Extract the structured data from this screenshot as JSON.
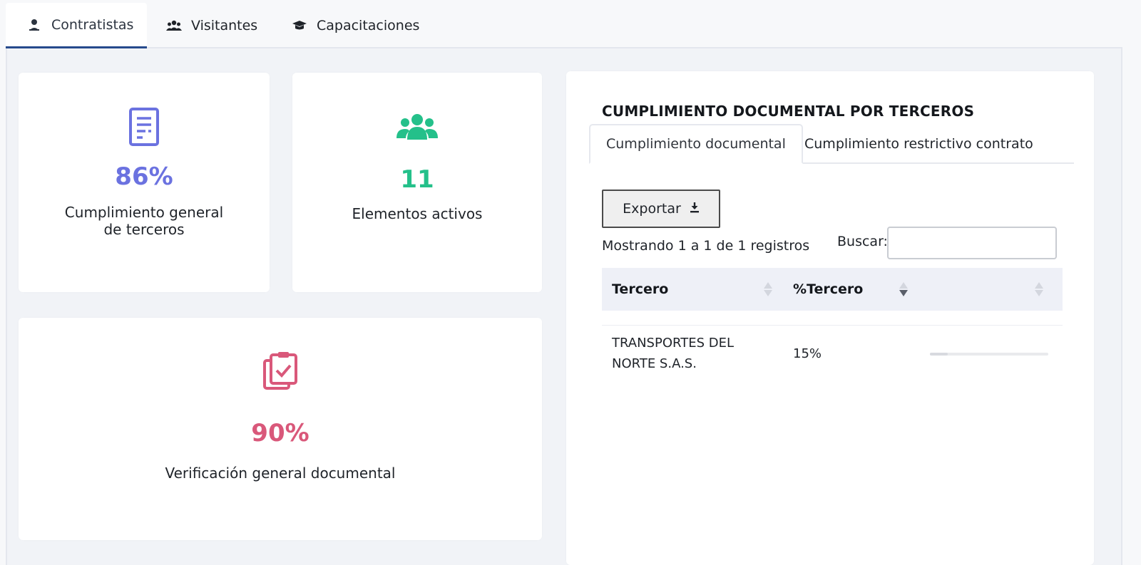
{
  "top_tabs": [
    {
      "label": "Contratistas",
      "icon": "person-icon",
      "active": true
    },
    {
      "label": "Visitantes",
      "icon": "people-icon",
      "active": false
    },
    {
      "label": "Capacitaciones",
      "icon": "graduation-cap-icon",
      "active": false
    }
  ],
  "stats": {
    "compliance": {
      "value": "86%",
      "label_line1": "Cumplimiento general",
      "label_line2": "de terceros",
      "icon": "document-icon",
      "color": "#6b72e0"
    },
    "active": {
      "value": "11",
      "label": "Elementos activos",
      "icon": "group-icon",
      "color": "#24c08a"
    },
    "verification": {
      "value": "90%",
      "label": "Verificación general documental",
      "icon": "clipboard-check-icon",
      "color": "#d9587a"
    }
  },
  "panel": {
    "title": "CUMPLIMIENTO DOCUMENTAL POR TERCEROS",
    "tabs": [
      {
        "label": "Cumplimiento documental",
        "active": true
      },
      {
        "label": "Cumplimiento restrictivo contrato",
        "active": false
      }
    ],
    "export_label": "Exportar",
    "info": "Mostrando 1 a 1 de 1 registros",
    "search_label": "Buscar:",
    "search_value": "",
    "columns": [
      "Tercero",
      "%Tercero"
    ],
    "rows": [
      {
        "tercero_line1": "TRANSPORTES DEL",
        "tercero_line2": "NORTE S.A.S.",
        "percent": "15%",
        "progress": 0.15
      }
    ]
  }
}
